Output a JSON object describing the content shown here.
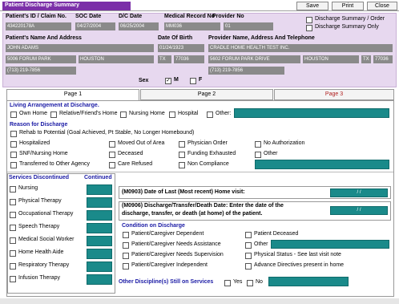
{
  "window": {
    "title": "Patient Discharge Summary",
    "buttons": {
      "save": "Save",
      "print": "Print",
      "close": "Close"
    }
  },
  "header": {
    "patient_id_label": "Patient's ID",
    "claim_no_label": "Claim No.",
    "patient_id_value": "434220178A",
    "soc_date_label": "SOC Date",
    "soc_date_value": "04/27/2004",
    "dc_date_label": "D/C Date",
    "dc_date_value": "06/25/2004",
    "medical_record_label": "Medical Record No",
    "medical_record_value": "MM036",
    "provider_no_label": "Provider No",
    "provider_no_value": "01",
    "option_dc_summary_order": "Discharge Summary / Order",
    "option_dc_summary_only": "Discharge Summary Only",
    "patient_name_label": "Patient's Name And Address",
    "patient_name_value": "JOHN ADAMS",
    "patient_address_value": "5006 FORUM PARK",
    "patient_city_value": "HOUSTON",
    "patient_state_value": "TX",
    "patient_zip_value": "77036",
    "patient_phone_value": "(713) 219-7856",
    "dob_label": "Date Of Birth",
    "dob_value": "01/24/1923",
    "sex_label": "Sex",
    "sex_m_label": "M",
    "sex_f_label": "F",
    "provider_name_label": "Provider Name,  Address And Telephone",
    "provider_name_value": "CRADLE HOME HEALTH TEST INC.",
    "provider_address_value": "5602 FORUM PARK DRIVE",
    "provider_city_value": "HOUSTON",
    "provider_state_value": "TX",
    "provider_zip_value": "77036",
    "provider_phone_value": "(713) 219-7856"
  },
  "tabs": {
    "page1": "Page 1",
    "page2": "Page 2",
    "page3": "Page 3"
  },
  "living": {
    "title": "Living Arrangement at Discharge.",
    "own_home": "Own Home",
    "relative_home": "Relative/Friend's Home",
    "nursing_home": "Nursing Home",
    "hospital": "Hospital",
    "other": "Other:"
  },
  "reason": {
    "title": "Reason for Discharge",
    "rehab": "Rehab to Potential (Goal Achieved, Pt Stable, No Longer Homebound)",
    "hospitalized": "Hospitalized",
    "moved": "Moved Out of Area",
    "physician_order": "Physician Order",
    "no_authorization": "No Authorization",
    "snf": "SNF/Nursing Home",
    "deceased": "Deceased",
    "funding": "Funding Exhausted",
    "other": "Other",
    "transferred": "Transferred to Other Agency",
    "care_refused": "Care Refused",
    "non_compliance": "Non Compliance"
  },
  "services": {
    "title": "Services Discontinued",
    "continued": "Continued",
    "items": [
      "Nursing",
      "Physical Therapy",
      "Occupational Therapy",
      "Speech Therapy",
      "Medical Social Worker",
      "Home Health Aide",
      "Respiratory Therapy",
      "Infusion Therapy"
    ]
  },
  "m0903": {
    "label": "(M0903) Date of Last (Most recent) Home visit:",
    "value": "/ /"
  },
  "m0906": {
    "label_line1": "(M0906) Discharge/Transfer/Death Date: Enter the date of the",
    "label_line2": "discharge, transfer, or death (at home) of the patient.",
    "value": "/ /"
  },
  "condition": {
    "title": "Condition on Discharge",
    "dependent": "Patient/Caregiver Dependent",
    "deceased": "Patient Deceased",
    "needs_assistance": "Patient/Caregiver Needs Assistance",
    "other": "Other",
    "needs_supervision": "Patient/Caregiver Needs Supervision",
    "physical_status": "Physical Status - See last visit note",
    "independent": "Patient/Caregiver Independent",
    "advance_directives": "Advance Directives present in home"
  },
  "other_discipline": {
    "label": "Other Discipline(s) Still on Services",
    "yes": "Yes",
    "no": "No"
  },
  "colors": {
    "title_bar": "#7b2fa8",
    "header_bg": "#e7d8ef",
    "field_bg": "#8a8a8a",
    "teal": "#1a8a8a",
    "section_blue": "#1a1aa5",
    "page3_red": "#b02020"
  }
}
